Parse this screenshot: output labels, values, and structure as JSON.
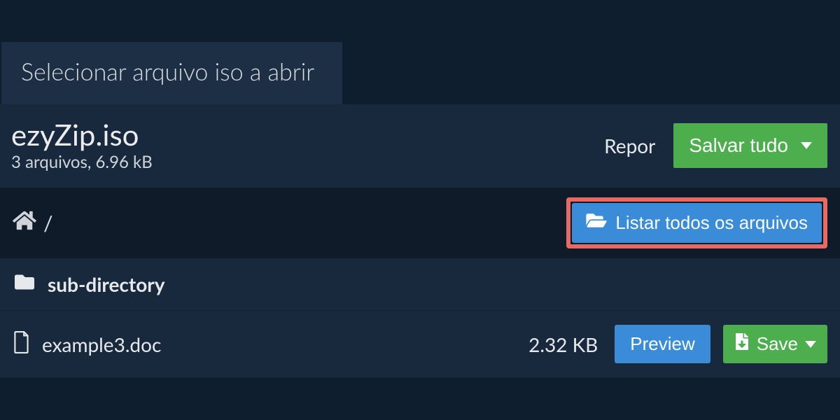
{
  "tab": {
    "label": "Selecionar arquivo iso a abrir"
  },
  "file": {
    "name": "ezyZip.iso",
    "summary": "3 arquivos, 6.96 kB"
  },
  "actions": {
    "reset": "Repor",
    "save_all": "Salvar tudo"
  },
  "breadcrumb": {
    "path": "/",
    "list_all": "Listar todos os arquivos"
  },
  "rows": [
    {
      "type": "folder",
      "name": "sub-directory"
    },
    {
      "type": "file",
      "name": "example3.doc",
      "size": "2.32 KB",
      "preview": "Preview",
      "save": "Save"
    }
  ]
}
